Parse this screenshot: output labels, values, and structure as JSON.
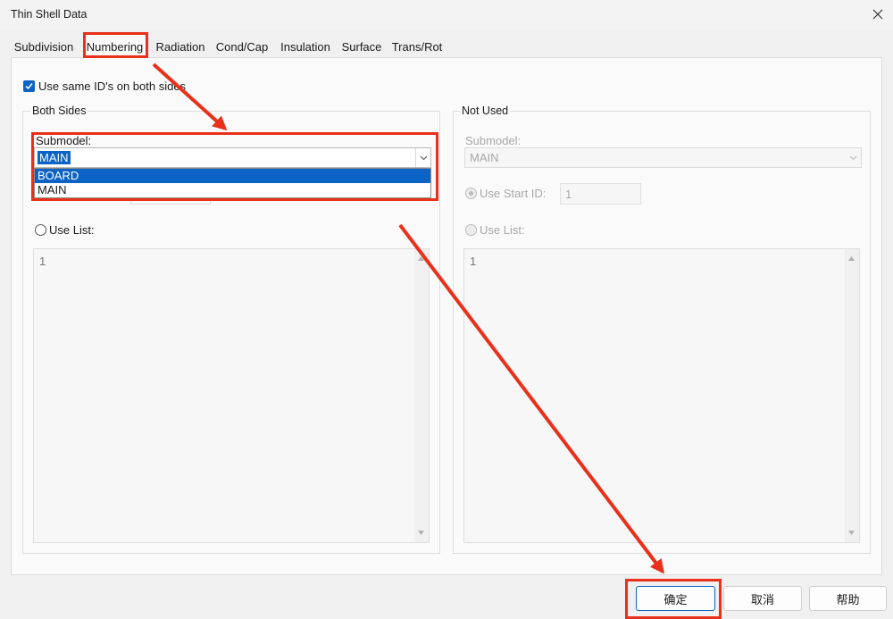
{
  "window": {
    "title": "Thin Shell Data"
  },
  "tabs": [
    {
      "label": "Subdivision"
    },
    {
      "label": "Numbering"
    },
    {
      "label": "Radiation"
    },
    {
      "label": "Cond/Cap"
    },
    {
      "label": "Insulation"
    },
    {
      "label": "Surface"
    },
    {
      "label": "Trans/Rot"
    }
  ],
  "numbering": {
    "same_ids_label": "Use same ID's on both sides",
    "both_sides": {
      "group_label": "Both Sides",
      "submodel_label": "Submodel:",
      "submodel_value": "MAIN",
      "dropdown_options": [
        "BOARD",
        "MAIN"
      ],
      "use_list_label": "Use List:",
      "list_value": "1"
    },
    "not_used": {
      "group_label": "Not Used",
      "submodel_label": "Submodel:",
      "submodel_value": "MAIN",
      "start_id_label": "Use Start ID:",
      "start_id_value": "1",
      "use_list_label": "Use List:",
      "list_value": "1"
    }
  },
  "buttons": {
    "ok": "确定",
    "cancel": "取消",
    "help": "帮助"
  },
  "colors": {
    "accent": "#0b63c5",
    "annotation": "#e8301b"
  }
}
